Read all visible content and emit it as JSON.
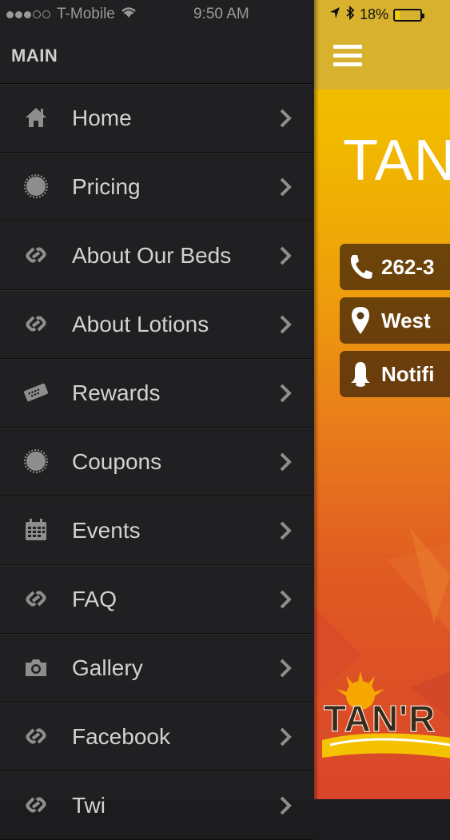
{
  "status_bar": {
    "carrier": "T-Mobile",
    "time": "9:50 AM",
    "battery": "18%",
    "battery_level": 0.18
  },
  "sidebar": {
    "title": "MAIN",
    "items": [
      {
        "label": "Home",
        "icon": "home-icon"
      },
      {
        "label": "Pricing",
        "icon": "seal-icon"
      },
      {
        "label": "About Our Beds",
        "icon": "link-icon"
      },
      {
        "label": "About Lotions",
        "icon": "link-icon"
      },
      {
        "label": "Rewards",
        "icon": "ticket-icon"
      },
      {
        "label": "Coupons",
        "icon": "seal-icon"
      },
      {
        "label": "Events",
        "icon": "calendar-icon"
      },
      {
        "label": "FAQ",
        "icon": "link-icon"
      },
      {
        "label": "Gallery",
        "icon": "camera-icon"
      },
      {
        "label": "Facebook",
        "icon": "link-icon"
      },
      {
        "label": "Twi",
        "icon": "link-icon"
      }
    ]
  },
  "main": {
    "brand_title": "TAN",
    "buttons": [
      {
        "label": "262-3",
        "icon": "phone-icon"
      },
      {
        "label": "West",
        "icon": "location-pin-icon"
      },
      {
        "label": "Notifi",
        "icon": "bell-icon"
      }
    ],
    "logo_text": "TAN'R"
  },
  "colors": {
    "sidebar_bg": "#202022",
    "header_bar": "#d8b22e",
    "gradient_top": "#f2c400",
    "gradient_bottom": "#d9462a"
  }
}
